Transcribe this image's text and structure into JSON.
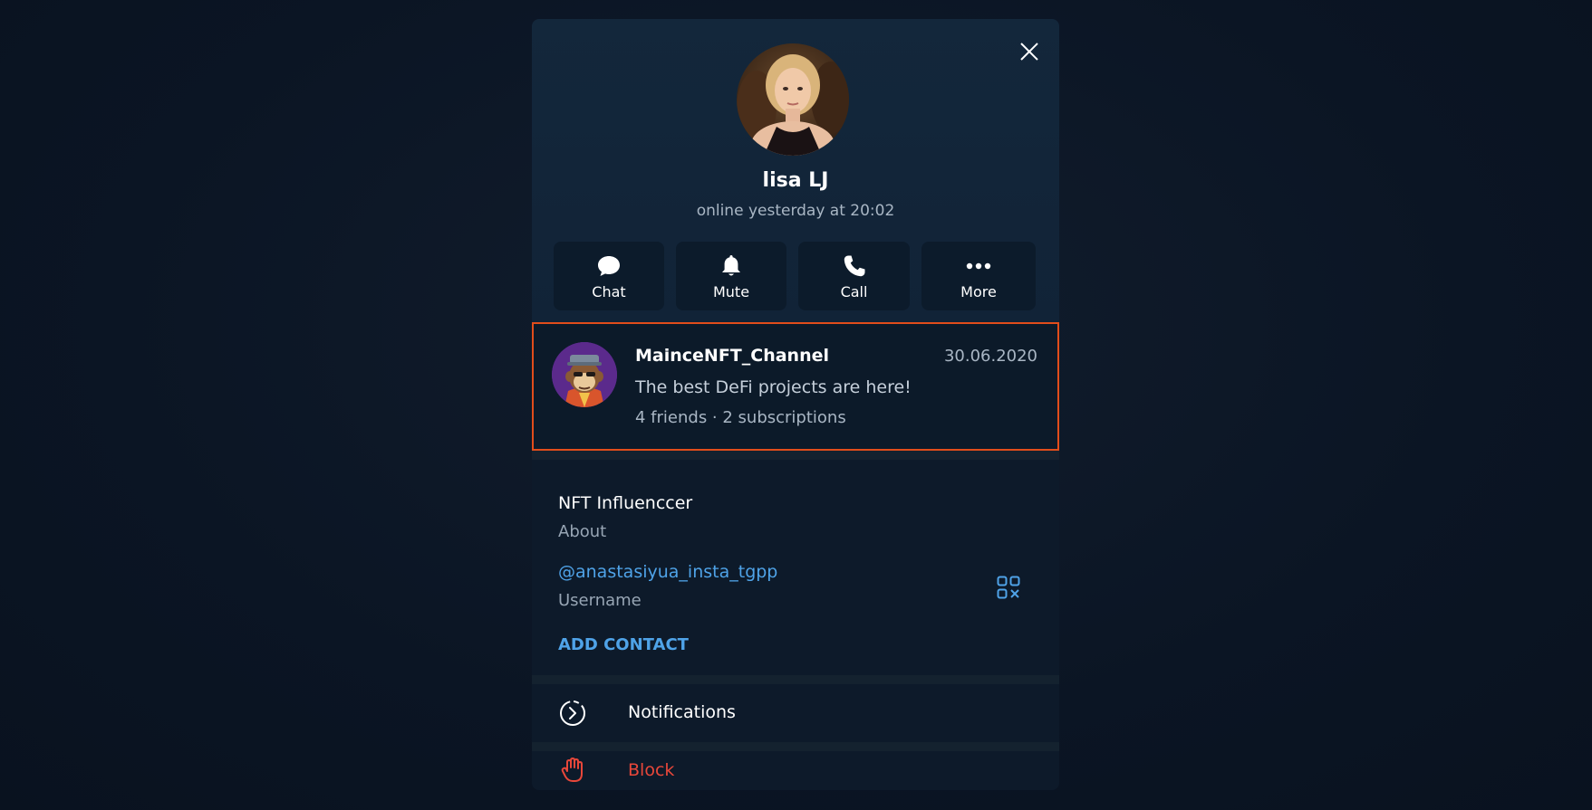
{
  "profile": {
    "name": "lisa LJ",
    "status": "online yesterday at 20:02"
  },
  "actions": [
    {
      "label": "Chat",
      "icon": "chat-bubble-icon"
    },
    {
      "label": "Mute",
      "icon": "bell-icon"
    },
    {
      "label": "Call",
      "icon": "phone-icon"
    },
    {
      "label": "More",
      "icon": "more-dots-icon"
    }
  ],
  "channel": {
    "name": "MainceNFT_Channel",
    "date": "30.06.2020",
    "description": "The best DeFi projects are here!",
    "stats": "4 friends · 2 subscriptions"
  },
  "info": {
    "about_value": "NFT Influenccer",
    "about_label": "About",
    "username_value": "@anastasiyua_insta_tgpp",
    "username_label": "Username",
    "add_contact": "ADD CONTACT"
  },
  "menu": {
    "notifications": "Notifications",
    "block": "Block"
  },
  "colors": {
    "accent": "#4fa3e8",
    "danger": "#e8473a",
    "highlight": "#e24d1b",
    "background": "#0b1524",
    "card": "#0d1a2a"
  }
}
